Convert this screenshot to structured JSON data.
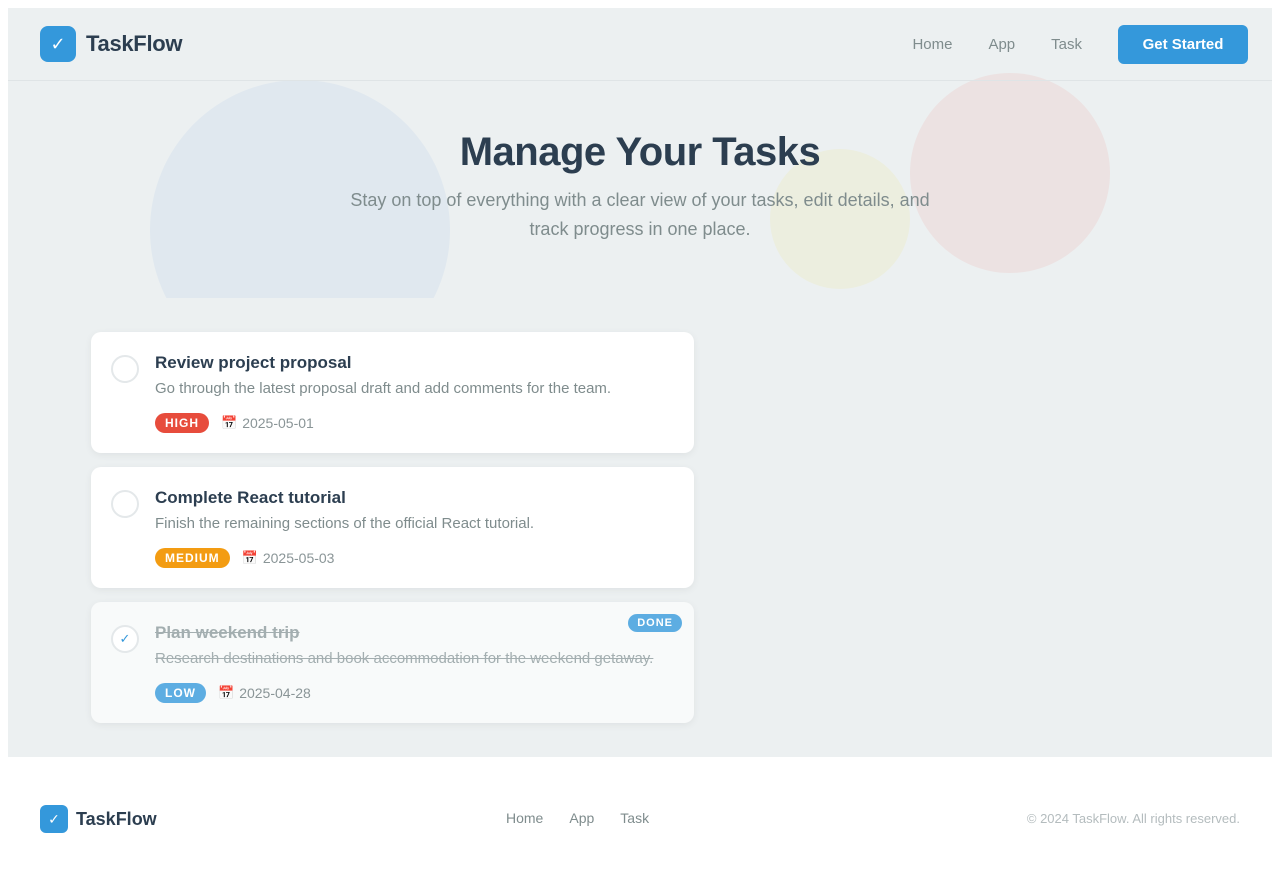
{
  "brand": {
    "name": "TaskFlow",
    "icon": "check-icon",
    "color": "#3498db"
  },
  "nav": {
    "links": [
      "Home",
      "App",
      "Task"
    ],
    "cta_label": "Get Started"
  },
  "hero": {
    "title": "Manage Your Tasks",
    "subtitle": "Stay on top of everything with a clear view of your tasks, edit details, and track progress in one place."
  },
  "tasks": [
    {
      "title": "Review project proposal",
      "description": "Go through the latest proposal draft and add comments for the team.",
      "priority": "HIGH",
      "priority_color": "#e74c3c",
      "date": "2025-05-01",
      "completed": false
    },
    {
      "title": "Complete React tutorial",
      "description": "Finish the remaining sections of the official React tutorial.",
      "priority": "MEDIUM",
      "priority_color": "#f39c12",
      "date": "2025-05-03",
      "completed": false
    },
    {
      "title": "Plan weekend trip",
      "description": "Research destinations and book accommodation for the weekend getaway.",
      "priority": "LOW",
      "priority_color": "#5dade2",
      "date": "2025-04-28",
      "completed": true,
      "status_badge": "DONE"
    }
  ],
  "footer": {
    "brand": "TaskFlow",
    "links": [
      "Home",
      "App",
      "Task"
    ],
    "copyright": "© 2024 TaskFlow. All rights reserved."
  }
}
